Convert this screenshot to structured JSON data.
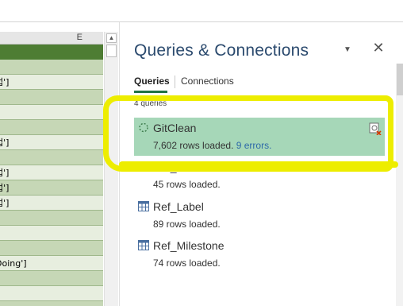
{
  "sheet": {
    "column_label": "E",
    "rows": [
      {
        "text": "",
        "style": "dark"
      },
      {
        "text": "",
        "style": "light"
      },
      {
        "text": "업']",
        "style": "white"
      },
      {
        "text": "",
        "style": "light"
      },
      {
        "text": "",
        "style": "white"
      },
      {
        "text": "",
        "style": "light"
      },
      {
        "text": "업']",
        "style": "white"
      },
      {
        "text": "",
        "style": "light"
      },
      {
        "text": "업']",
        "style": "white"
      },
      {
        "text": "업']",
        "style": "light"
      },
      {
        "text": "업']",
        "style": "white"
      },
      {
        "text": "",
        "style": "light"
      },
      {
        "text": "",
        "style": "white"
      },
      {
        "text": "",
        "style": "light"
      },
      {
        "text": "Doing']",
        "style": "white"
      },
      {
        "text": "",
        "style": "light"
      },
      {
        "text": "",
        "style": "white"
      },
      {
        "text": "",
        "style": "light"
      }
    ]
  },
  "pane": {
    "title": "Queries & Connections",
    "tabs": [
      {
        "label": "Queries",
        "active": true
      },
      {
        "label": "Connections",
        "active": false
      }
    ],
    "count_label": "4 queries",
    "queries": [
      {
        "name": "GitClean",
        "rows_text": "7,602 rows loaded.",
        "errors_text": "9 errors.",
        "selected": true,
        "icon": "loading-dotted-circle-icon"
      },
      {
        "name": "Ref_Role",
        "rows_text": "45 rows loaded.",
        "errors_text": "",
        "selected": false,
        "icon": "table-icon"
      },
      {
        "name": "Ref_Label",
        "rows_text": "89 rows loaded.",
        "errors_text": "",
        "selected": false,
        "icon": "table-icon"
      },
      {
        "name": "Ref_Milestone",
        "rows_text": "74 rows loaded.",
        "errors_text": "",
        "selected": false,
        "icon": "table-icon"
      }
    ]
  },
  "colors": {
    "selected_bg": "#a6d7b8",
    "header_green": "#4e7d33",
    "highlight_yellow": "#eded00",
    "error_link": "#2e6aa8",
    "tab_underline": "#217346"
  }
}
